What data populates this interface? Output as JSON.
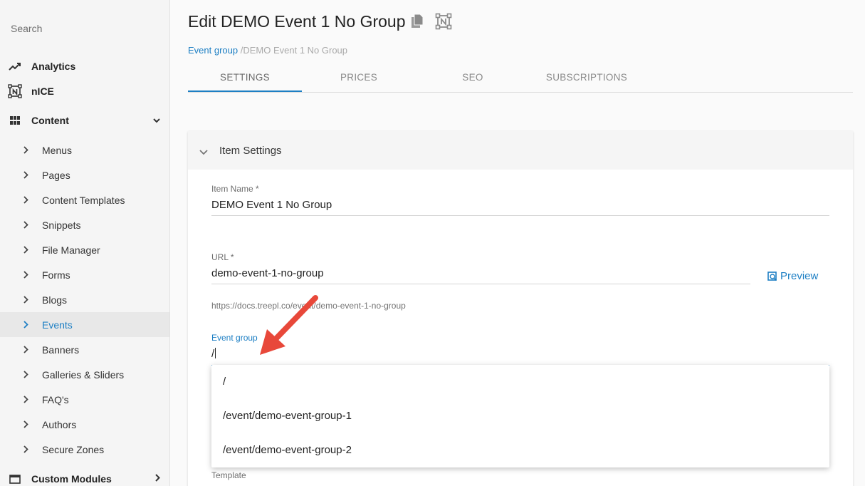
{
  "sidebar": {
    "search_placeholder": "Search",
    "top_items": [
      {
        "label": "Analytics",
        "icon": "trend-icon"
      },
      {
        "label": "nICE",
        "icon": "nice-icon"
      },
      {
        "label": "Content",
        "icon": "grid-icon"
      }
    ],
    "content_items": [
      "Menus",
      "Pages",
      "Content Templates",
      "Snippets",
      "File Manager",
      "Forms",
      "Blogs",
      "Events",
      "Banners",
      "Galleries & Sliders",
      "FAQ's",
      "Authors",
      "Secure Zones"
    ],
    "active_item": "Events",
    "bottom_item": {
      "label": "Custom Modules",
      "icon": "window-icon"
    }
  },
  "header": {
    "title": "Edit DEMO Event 1 No Group",
    "breadcrumb_link": "Event group",
    "breadcrumb_current": "/DEMO Event 1 No Group"
  },
  "tabs": [
    "SETTINGS",
    "PRICES",
    "SEO",
    "SUBSCRIPTIONS"
  ],
  "active_tab": "SETTINGS",
  "card": {
    "title": "Item Settings",
    "item_name_label": "Item Name *",
    "item_name_value": "DEMO Event 1 No Group",
    "url_label": "URL *",
    "url_value": "demo-event-1-no-group",
    "url_hint": "https://docs.treepl.co/event/demo-event-1-no-group",
    "preview_label": "Preview",
    "event_group_label": "Event group",
    "event_group_value": "/",
    "template_label": "Template"
  },
  "dropdown_options": [
    "/",
    "/event/demo-event-group-1",
    "/event/demo-event-group-2"
  ],
  "colors": {
    "accent": "#1d7fc4",
    "arrow": "#e8483a"
  }
}
